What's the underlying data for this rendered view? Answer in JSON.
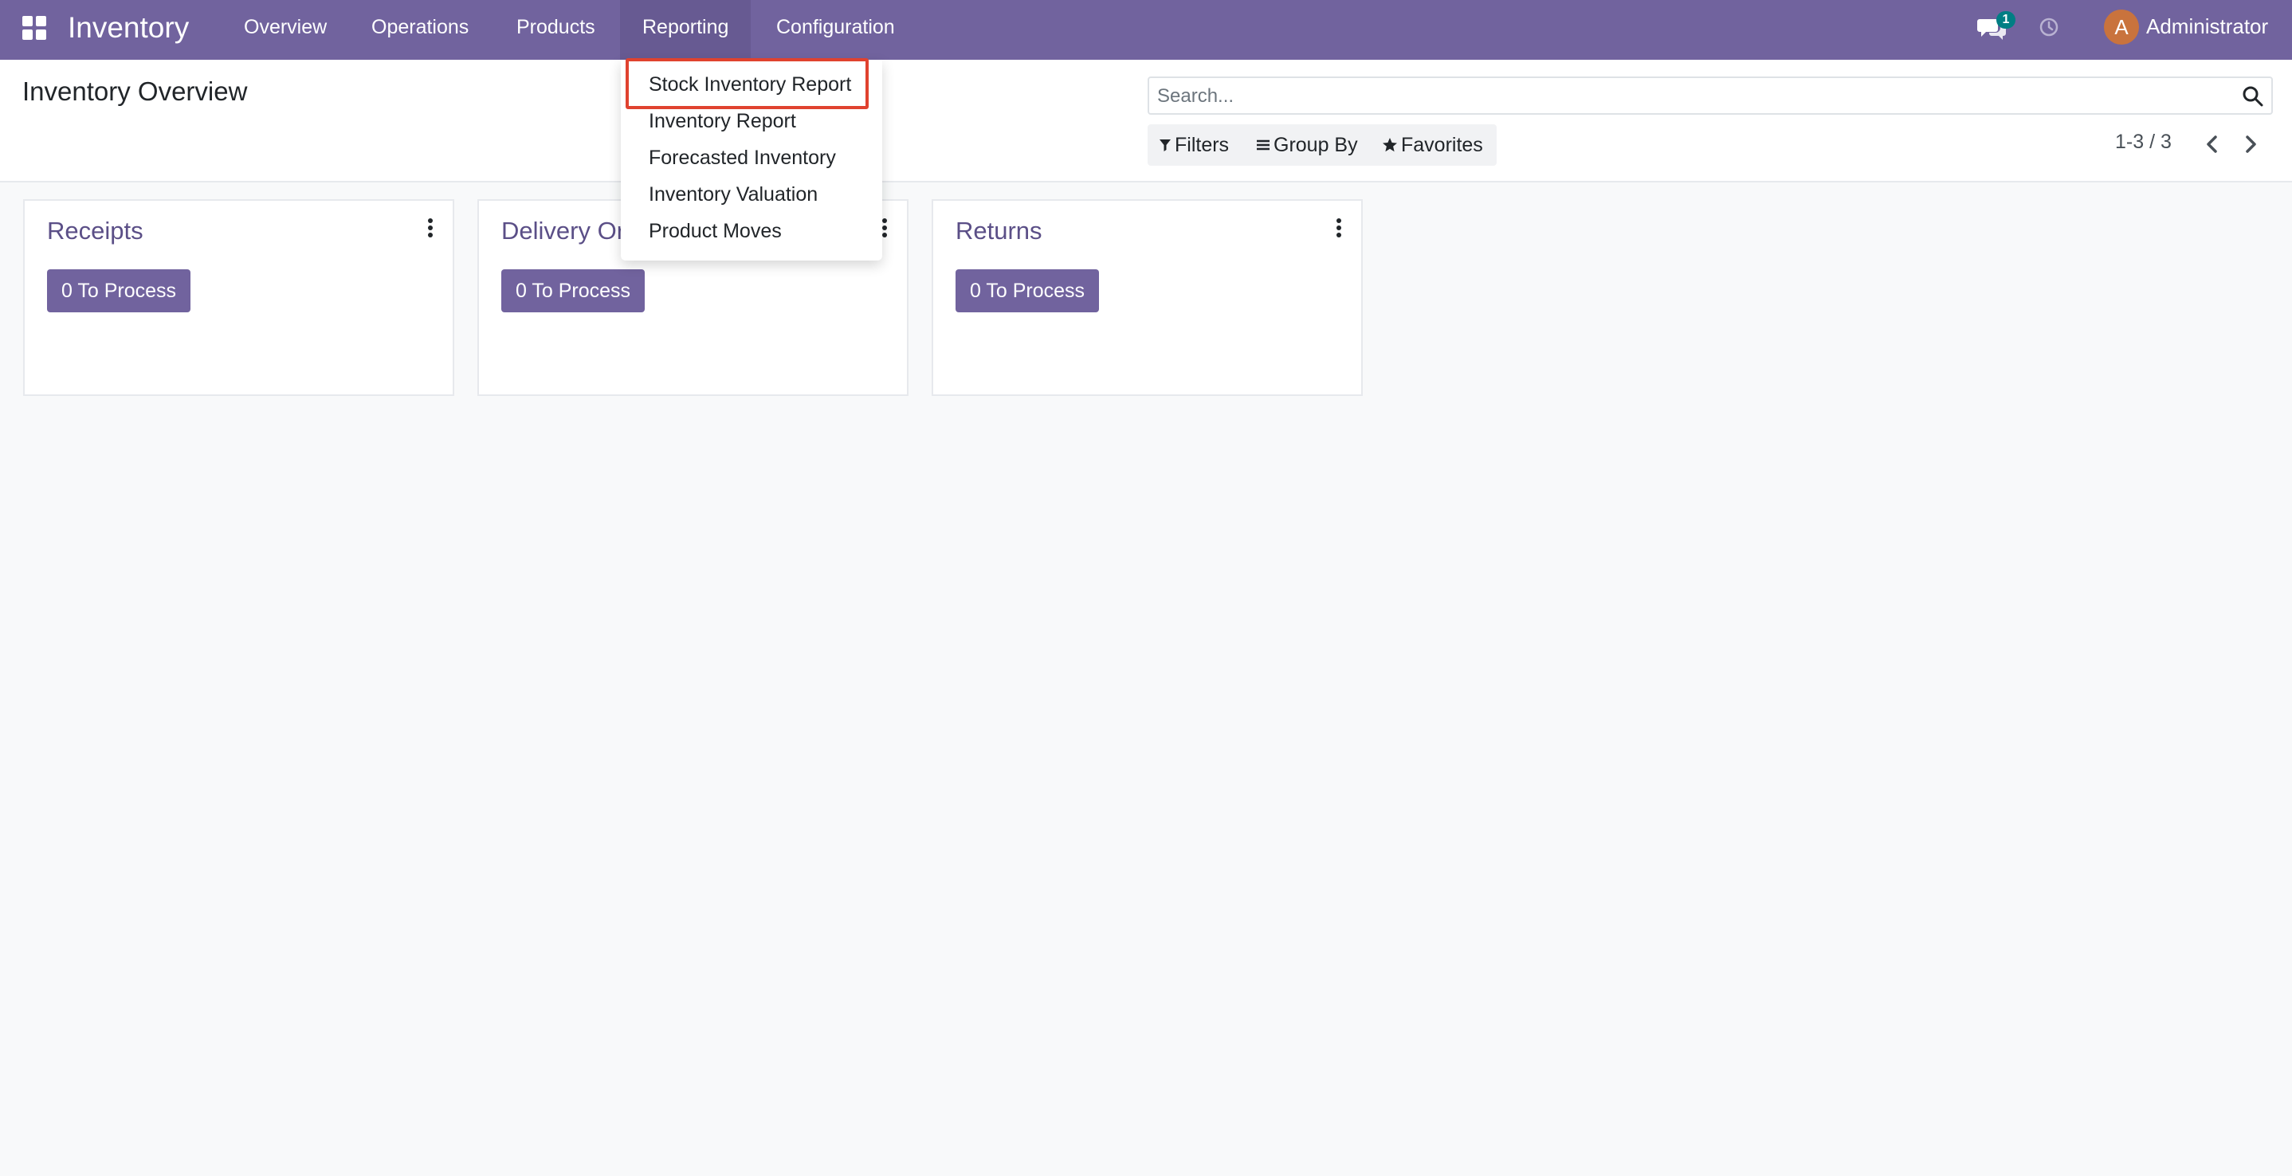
{
  "navbar": {
    "brand": "Inventory",
    "items": [
      {
        "label": "Overview"
      },
      {
        "label": "Operations"
      },
      {
        "label": "Products"
      },
      {
        "label": "Reporting"
      },
      {
        "label": "Configuration"
      }
    ],
    "active_item": "Reporting",
    "chat_badge": "1",
    "avatar_letter": "A",
    "user_name": "Administrator",
    "colors": {
      "bar": "#71639e",
      "badge": "#017e84",
      "avatar": "#c9733d"
    }
  },
  "control_panel": {
    "title": "Inventory Overview",
    "search_placeholder": "Search...",
    "filters_label": "Filters",
    "group_by_label": "Group By",
    "favorites_label": "Favorites",
    "pager_text": "1-3 / 3"
  },
  "cards": [
    {
      "title": "Receipts",
      "button": "0 To Process"
    },
    {
      "title": "Delivery Orders",
      "button": "0 To Process"
    },
    {
      "title": "Returns",
      "button": "0 To Process"
    }
  ],
  "reporting_menu": {
    "items": [
      {
        "label": "Stock Inventory Report",
        "highlighted": true
      },
      {
        "label": "Inventory Report"
      },
      {
        "label": "Forecasted Inventory"
      },
      {
        "label": "Inventory Valuation"
      },
      {
        "label": "Product Moves"
      }
    ],
    "highlight_color": "#e0422f"
  }
}
